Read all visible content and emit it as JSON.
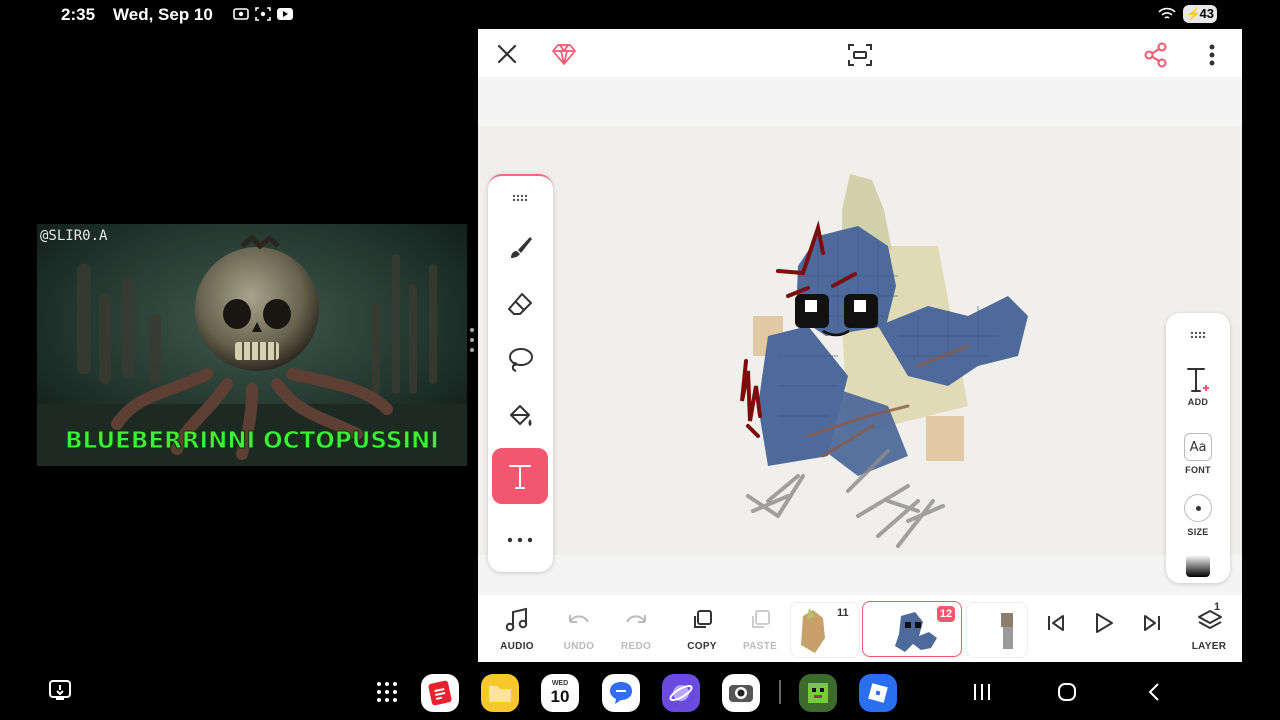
{
  "status_bar": {
    "time": "2:35",
    "date": "Wed, Sep 10",
    "battery": "43"
  },
  "video": {
    "watermark": "@SLIR0.A",
    "caption": "BLUEBERRINNI OCTOPUSSINI",
    "caption_color": "#3ef03a"
  },
  "app": {
    "accent": "#f3566f",
    "top_bar": {
      "close_icon": "close-icon",
      "gem_icon": "gem-icon",
      "fit_icon": "fit-screen-icon",
      "share_icon": "share-icon",
      "more_icon": "more-vertical-icon"
    },
    "tools": [
      "brush",
      "eraser",
      "lasso",
      "fill",
      "text",
      "more"
    ],
    "text_panel": {
      "add_label": "ADD",
      "font_sample": "Aa",
      "font_label": "FONT",
      "size_label": "SIZE"
    },
    "bottom_bar": {
      "audio_label": "AUDIO",
      "undo_label": "UNDO",
      "redo_label": "REDO",
      "copy_label": "COPY",
      "paste_label": "PASTE",
      "layer_label": "LAYER",
      "layer_count": "1",
      "frames": [
        {
          "number": "11"
        },
        {
          "number": "12"
        },
        {
          "number": ""
        }
      ]
    }
  },
  "dock": {
    "calendar_day": "WED",
    "calendar_date": "10"
  }
}
